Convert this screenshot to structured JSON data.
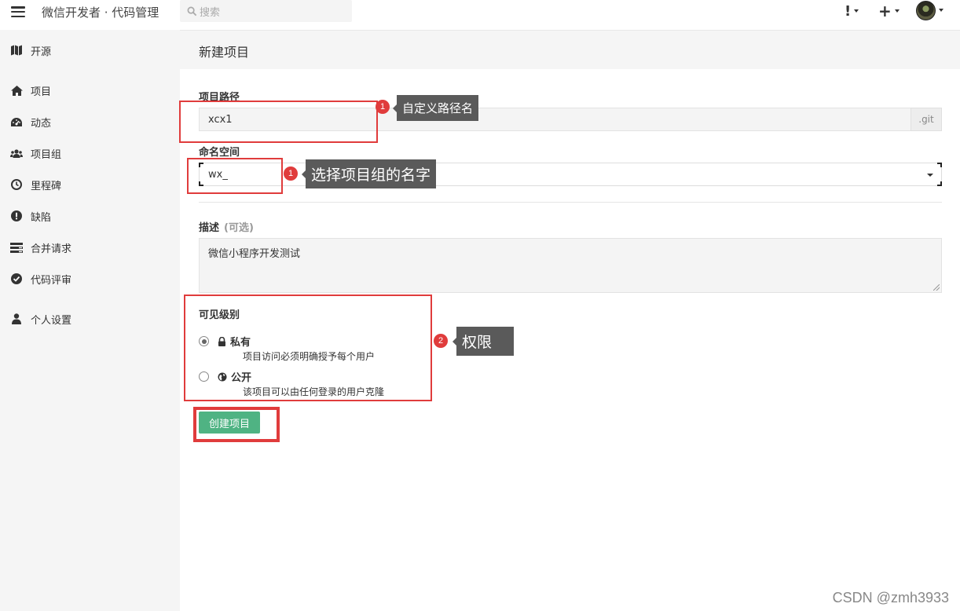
{
  "topbar": {
    "title": "微信开发者 · 代码管理",
    "search_placeholder": "搜索",
    "alert_label": "!",
    "plus_label": "+"
  },
  "sidebar": {
    "items": [
      {
        "label": "开源",
        "icon": "map-icon"
      },
      {
        "label": "项目",
        "icon": "home-icon"
      },
      {
        "label": "动态",
        "icon": "dashboard-icon"
      },
      {
        "label": "项目组",
        "icon": "group-icon"
      },
      {
        "label": "里程碑",
        "icon": "clock-icon"
      },
      {
        "label": "缺陷",
        "icon": "exclamation-icon"
      },
      {
        "label": "合并请求",
        "icon": "list-icon"
      },
      {
        "label": "代码评审",
        "icon": "check-circle-icon"
      },
      {
        "label": "个人设置",
        "icon": "user-icon"
      }
    ]
  },
  "page": {
    "title": "新建项目"
  },
  "form": {
    "path_label": "项目路径",
    "path_value": "xcx1",
    "path_suffix": ".git",
    "namespace_label": "命名空间",
    "namespace_value": "wx_",
    "description_label": "描述",
    "description_optional": "(可选)",
    "description_value": "微信小程序开发测试",
    "visibility_label": "可见级别",
    "visibility_options": [
      {
        "title": "私有",
        "desc": "项目访问必须明确授予每个用户",
        "selected": true,
        "icon": "lock-icon"
      },
      {
        "title": "公开",
        "desc": "该项目可以由任何登录的用户克隆",
        "selected": false,
        "icon": "globe-icon"
      }
    ],
    "submit_label": "创建项目"
  },
  "annotations": {
    "path_badge": "1",
    "path_note": "自定义路径名",
    "namespace_badge": "1",
    "namespace_note": "选择项目组的名字",
    "visibility_badge": "2",
    "visibility_note": "权限",
    "box_color": "#e03c3c"
  },
  "colors": {
    "accent_green": "#4fb383",
    "sidebar_bg": "#f5f5f5"
  },
  "watermark": "CSDN @zmh3933"
}
